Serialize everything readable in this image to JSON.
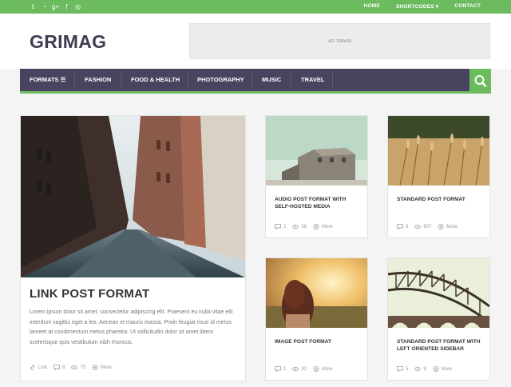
{
  "topbar": {
    "social_icons": [
      "twitter-icon",
      "rss-icon",
      "google-plus-icon",
      "facebook-icon",
      "instagram-icon"
    ],
    "links": [
      "HOME",
      "SHORTCODES ▾",
      "CONTACT"
    ]
  },
  "header": {
    "logo": "GRIMAG",
    "ad_text": "AD 768x90"
  },
  "nav": {
    "items": [
      "FORMATS ☰",
      "FASHION",
      "FOOD & HEALTH",
      "PHOTOGRAPHY",
      "MUSIC",
      "TRAVEL"
    ]
  },
  "colors": {
    "accent": "#6dbb5f",
    "nav_bg": "#4a4360",
    "logo": "#3d3d54"
  },
  "featured": {
    "title": "LINK POST FORMAT",
    "excerpt": "Lorem ipsum dolor sit amet, consectetur adipiscing elit. Praesent eu nulla vitae elit interdum sagittis eget a leo. Aenean et mauris massa. Proin feugiat risus id metus laoreet at condimentum metus pharetra. Ut sollicitudin dolor sit amet libero scelerisque quis vestibulum nibh rhoncus.",
    "meta": {
      "link": "Link",
      "comments": "8",
      "views": "75",
      "more": "More"
    }
  },
  "posts": [
    {
      "title": "AUDIO POST FORMAT WITH SELF-HOSTED MEDIA",
      "comments": "2",
      "views": "38",
      "more": "More"
    },
    {
      "title": "STANDARD POST FORMAT",
      "comments": "6",
      "views": "607",
      "more": "More"
    },
    {
      "title": "IMAGE POST FORMAT",
      "comments": "1",
      "views": "32",
      "more": "More"
    },
    {
      "title": "STANDARD POST FORMAT WITH LEFT ORIENTED SIDEBAR",
      "comments": "5",
      "views": "9",
      "more": "More"
    }
  ]
}
